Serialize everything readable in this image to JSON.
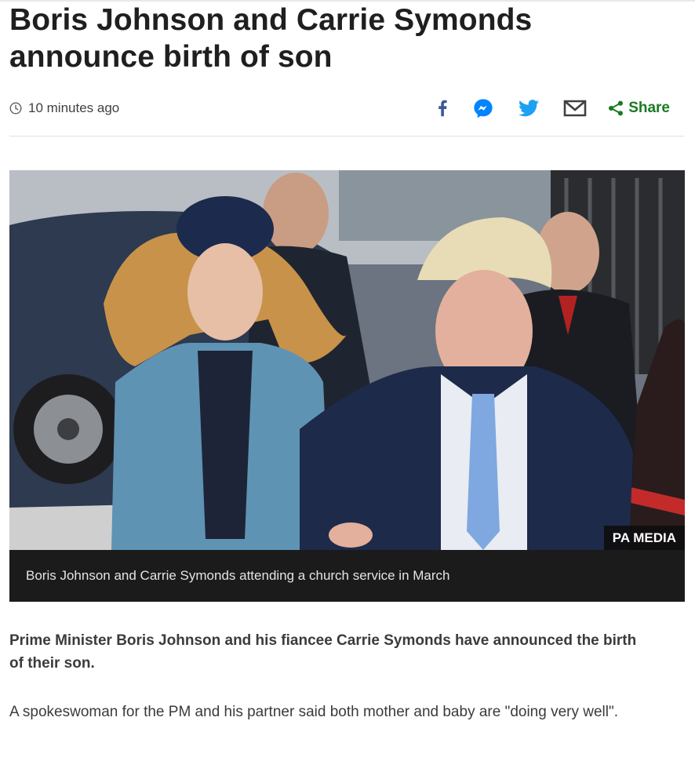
{
  "article": {
    "headline": "Boris Johnson and Carrie Symonds announce birth of son",
    "timestamp": "10 minutes ago",
    "share": {
      "share_label": "Share",
      "icons": [
        "facebook-icon",
        "messenger-icon",
        "twitter-icon",
        "email-icon",
        "share-icon"
      ],
      "colors": {
        "facebook": "#3b5998",
        "messenger": "#0084ff",
        "twitter": "#1da1f2",
        "email": "#404040",
        "share": "#1a7a24"
      }
    },
    "image": {
      "credit": "PA MEDIA",
      "caption": "Boris Johnson and Carrie Symonds attending a church service in March"
    },
    "intro": "Prime Minister Boris Johnson and his fiancee Carrie Symonds have announced the birth of their son.",
    "paragraphs": [
      "A spokeswoman for the PM and his partner said both mother and baby are \"doing very well\"."
    ]
  }
}
